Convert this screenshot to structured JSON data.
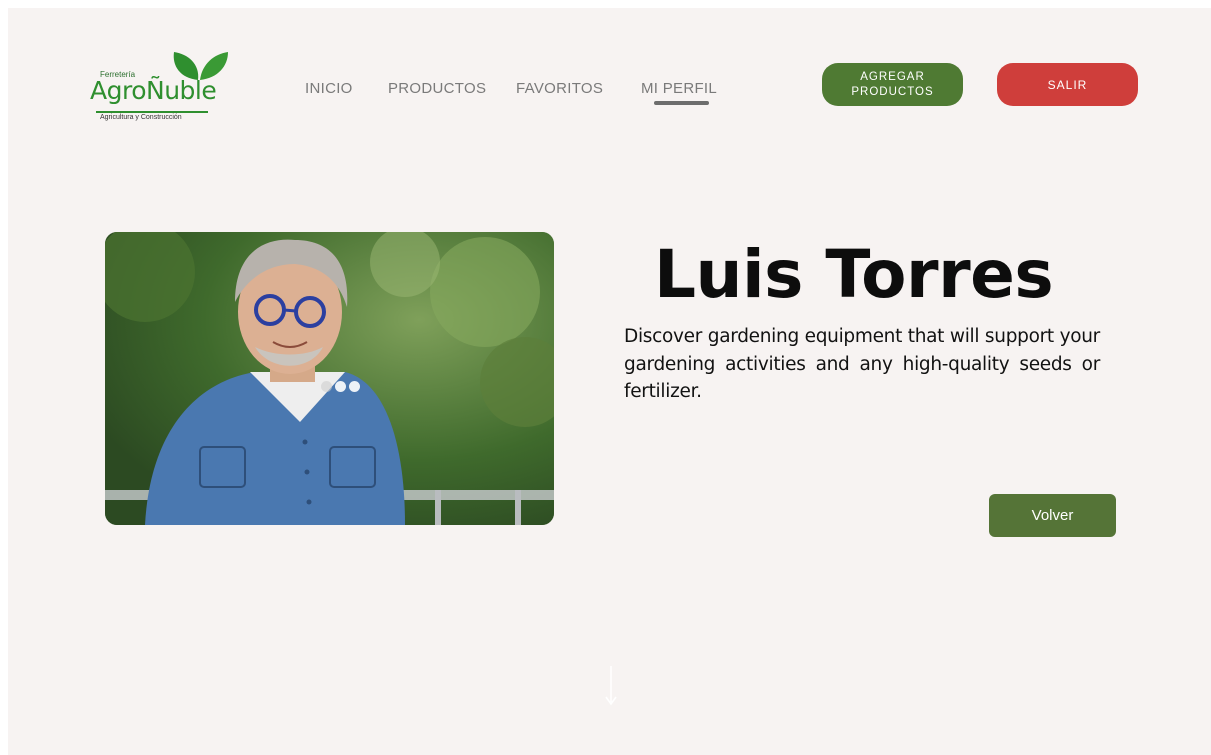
{
  "logo": {
    "small_text": "Ferretería",
    "brand": "AgroÑuble",
    "tagline": "Agricultura y Construcción",
    "icon": "leaves-icon",
    "color": "#2f8f2f"
  },
  "nav": {
    "items": [
      {
        "label": "INICIO"
      },
      {
        "label": "PRODUCTOS"
      },
      {
        "label": "FAVORITOS"
      },
      {
        "label": "MI PERFIL",
        "active": true
      }
    ]
  },
  "header_buttons": {
    "add_products": "AGREGAR PRODUCTOS",
    "exit": "SALIR"
  },
  "profile": {
    "name": "Luis Torres",
    "description": "Discover gardening equipment that will support your gardening activities and any high-quality seeds or fertilizer.",
    "photo_icon": "profile-photo",
    "carousel": {
      "dots": 3,
      "active": 2
    }
  },
  "actions": {
    "back": "Volver",
    "scroll_icon": "arrow-down-icon"
  },
  "colors": {
    "background": "#f7f3f2",
    "green": "#4f7a33",
    "red": "#cf3e3b"
  }
}
